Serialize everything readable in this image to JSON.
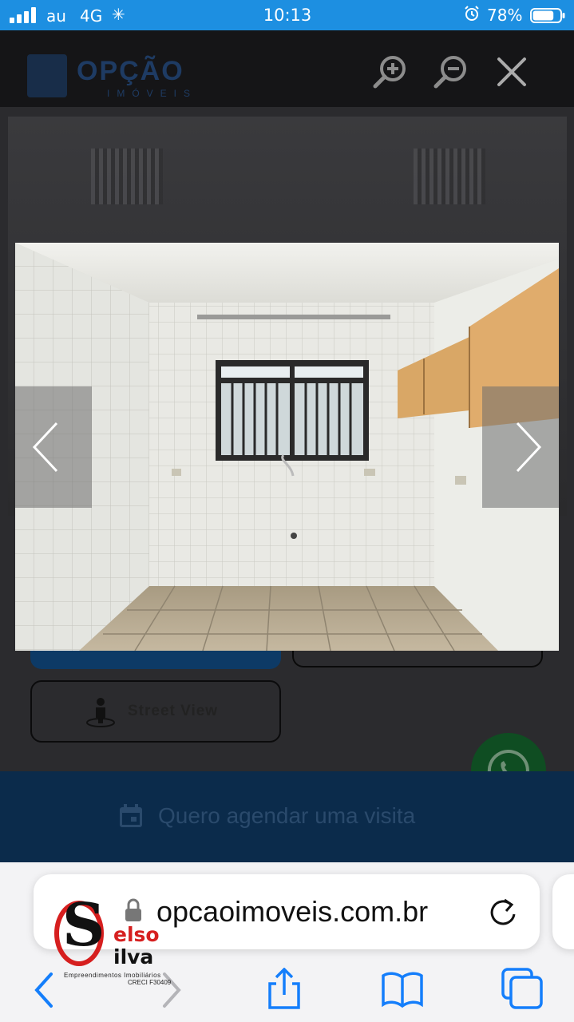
{
  "status_bar": {
    "carrier": "au",
    "network": "4G",
    "time": "10:13",
    "battery_percent": "78%",
    "battery_level": 0.78
  },
  "site": {
    "brand_name": "OPÇÃO",
    "brand_subtitle": "IMÓVEIS",
    "street_view_label": "Street View",
    "schedule_label": "Quero agendar uma visita"
  },
  "gallery": {
    "zoom_in_icon": "zoom-in-icon",
    "zoom_out_icon": "zoom-out-icon",
    "close_icon": "close-icon",
    "prev_icon": "chevron-left-icon",
    "next_icon": "chevron-right-icon"
  },
  "browser": {
    "url": "opcaoimoveis.com.br"
  },
  "watermark": {
    "letter_initial": "S",
    "first_line": "elso",
    "second_line": "ilva",
    "tagline": "Empreendimentos Imobiliários",
    "creci": "CRECI F30409"
  },
  "colors": {
    "status_bar": "#1d8fe1",
    "ios_blue": "#147efb",
    "watermark_red": "#d61f1f"
  }
}
